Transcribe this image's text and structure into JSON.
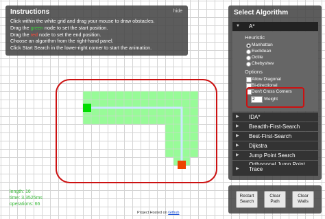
{
  "instructions": {
    "title": "Instructions",
    "hide_label": "hide",
    "line1": "Click within the white grid and drag your mouse to draw obstacles.",
    "line2_pre": "Drag the ",
    "line2_color": "green",
    "line2_post": " node to set the start position.",
    "line3_pre": "Drag the ",
    "line3_color": "red",
    "line3_post": " node to set the end position.",
    "line4": "Choose an algorithm from the right-hand panel.",
    "line5": "Click Start Search in the lower-right corner to start the animation."
  },
  "algorithm_panel": {
    "title": "Select Algorithm",
    "selected": "A*",
    "heuristic_label": "Heuristic",
    "heuristics": [
      "Manhattan",
      "Euclidean",
      "Octile",
      "Chebyshev"
    ],
    "selected_heuristic": "Manhattan",
    "options_label": "Options",
    "options": [
      "Allow Diagonal",
      "Bi-directional",
      "Don't Cross Corners"
    ],
    "weight_value": "2",
    "weight_label": "Weight",
    "algorithms": [
      "IDA*",
      "Breadth-First-Search",
      "Best-First-Search",
      "Dijkstra",
      "Jump Point Search",
      "Orthogonal Jump Point Search",
      "Trace"
    ]
  },
  "controls": {
    "restart": "Restart Search",
    "clear_path": "Clear Path",
    "clear_walls": "Clear Walls"
  },
  "stats": {
    "length": "length: 16",
    "time": "time: 3.3525ms",
    "operations": "operations: 66"
  },
  "footer": {
    "text": "Project Hosted on ",
    "link": "Github"
  },
  "colors": {
    "start_node": "#00dd00",
    "end_node": "#ee4400",
    "explored": "#98fb98",
    "path_line": "#cce8ff",
    "annotation": "#cc0000"
  }
}
